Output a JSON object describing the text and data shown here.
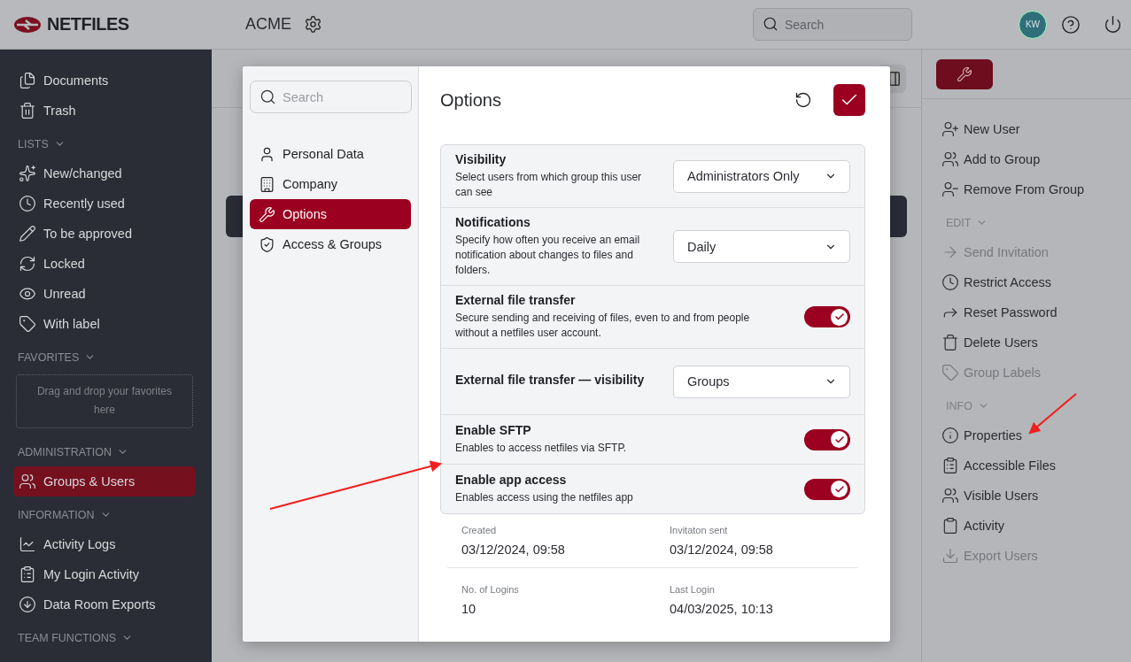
{
  "header": {
    "logo_text": "NETFILES",
    "workspace": "ACME",
    "search": {
      "placeholder": "Search"
    },
    "avatar": "KW"
  },
  "sidebar": {
    "sections": [
      {
        "items": [
          {
            "label": "Documents",
            "selected": false
          },
          {
            "label": "Trash",
            "selected": false
          }
        ]
      },
      {
        "title": "LISTS",
        "items": [
          {
            "label": "New/changed",
            "selected": false
          },
          {
            "label": "Recently used",
            "selected": false
          },
          {
            "label": "To be approved",
            "selected": false
          },
          {
            "label": "Locked",
            "selected": false
          },
          {
            "label": "Unread",
            "selected": false
          },
          {
            "label": "With label",
            "selected": false
          }
        ]
      },
      {
        "title": "FAVORITES",
        "dropzone": "Drag and drop your favorites here"
      },
      {
        "title": "ADMINISTRATION",
        "items": [
          {
            "label": "Groups & Users",
            "selected": true
          }
        ]
      },
      {
        "title": "INFORMATION",
        "items": [
          {
            "label": "Activity Logs",
            "selected": false
          },
          {
            "label": "My Login Activity",
            "selected": false
          },
          {
            "label": "Data Room Exports",
            "selected": false
          }
        ]
      },
      {
        "title": "TEAM FUNCTIONS"
      }
    ]
  },
  "actions_panel": {
    "sections": [
      {
        "items": [
          {
            "label": "New User",
            "disabled": false
          },
          {
            "label": "Add to Group",
            "disabled": false
          },
          {
            "label": "Remove From Group",
            "disabled": false
          }
        ]
      },
      {
        "title": "EDIT",
        "items": [
          {
            "label": "Send Invitation",
            "disabled": true
          },
          {
            "label": "Restrict Access",
            "disabled": false
          },
          {
            "label": "Reset Password",
            "disabled": false
          },
          {
            "label": "Delete Users",
            "disabled": false
          },
          {
            "label": "Group Labels",
            "disabled": true
          }
        ]
      },
      {
        "title": "INFO",
        "items": [
          {
            "label": "Properties",
            "disabled": false
          },
          {
            "label": "Accessible Files",
            "disabled": false
          },
          {
            "label": "Visible Users",
            "disabled": false
          },
          {
            "label": "Activity",
            "disabled": false
          },
          {
            "label": "Export Users",
            "disabled": true
          }
        ]
      }
    ]
  },
  "dialog": {
    "search": {
      "placeholder": "Search"
    },
    "nav": [
      {
        "label": "Personal Data",
        "selected": false
      },
      {
        "label": "Company",
        "selected": false
      },
      {
        "label": "Options",
        "selected": true
      },
      {
        "label": "Access & Groups",
        "selected": false
      }
    ],
    "title": "Options",
    "settings": [
      {
        "kind": "select",
        "title": "Visibility",
        "description": "Select users from which group this user can see",
        "value": "Administrators Only"
      },
      {
        "kind": "select",
        "title": "Notifications",
        "description": "Specify how often you receive an email notification about changes to files and folders.",
        "value": "Daily"
      },
      {
        "kind": "toggle",
        "title": "External file transfer",
        "description": "Secure sending and receiving of files, even to and from people without a netfiles user account.",
        "on": true
      },
      {
        "kind": "select",
        "title": "External file transfer — visibility",
        "value": "Groups"
      },
      {
        "kind": "toggle",
        "title": "Enable SFTP",
        "description": "Enables to access netfiles via SFTP.",
        "on": true
      },
      {
        "kind": "toggle",
        "title": "Enable app access",
        "description": "Enables access using the netfiles app",
        "on": true
      }
    ],
    "details": [
      {
        "label": "Created",
        "value": "03/12/2024, 09:58"
      },
      {
        "label": "Invitaton sent",
        "value": "03/12/2024, 09:58"
      },
      {
        "label": "No. of Logins",
        "value": "10"
      },
      {
        "label": "Last Login",
        "value": "04/03/2025, 10:13"
      }
    ]
  }
}
